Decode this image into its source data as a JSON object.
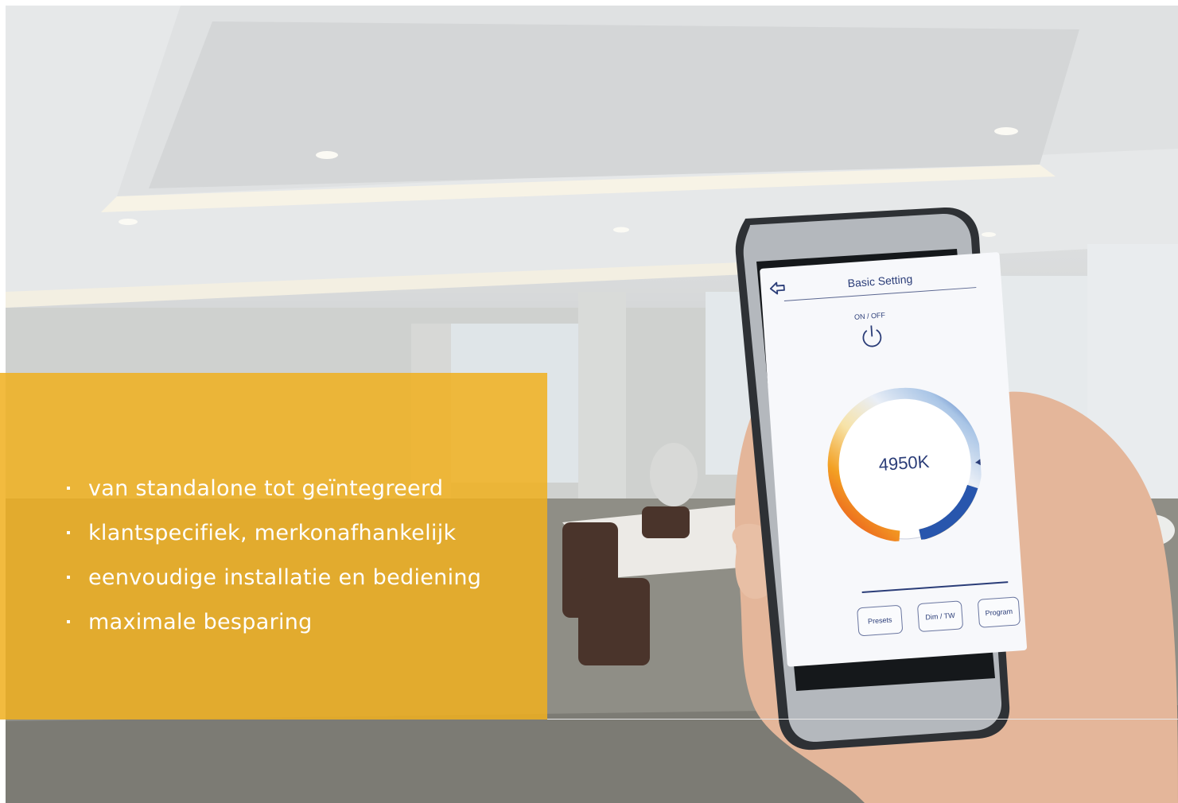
{
  "bullets": [
    "van standalone tot geïntegreerd",
    "klantspecifiek, merkonafhankelijk",
    "eenvoudige installatie en bediening",
    "maximale besparing"
  ],
  "phone": {
    "title": "Basic Setting",
    "onoff_label": "ON / OFF",
    "color_temp": "4950K",
    "buttons": [
      "Presets",
      "Dim / TW",
      "Program"
    ]
  },
  "colors": {
    "overlay": "#f0b01f",
    "screen_text": "#2b3d78"
  }
}
